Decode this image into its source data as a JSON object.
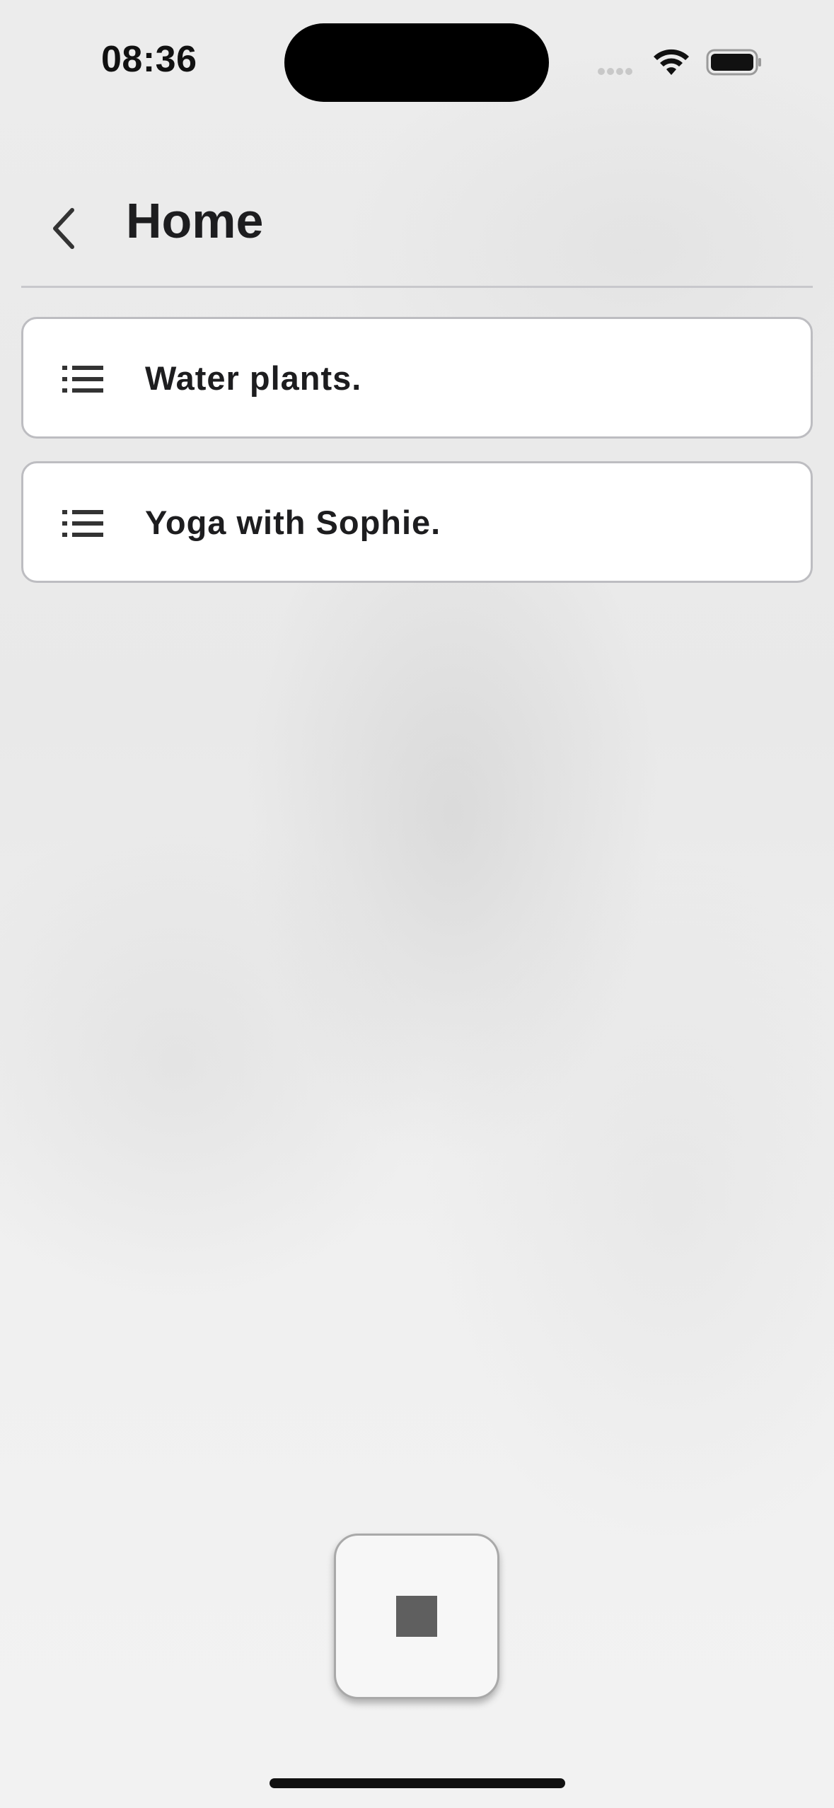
{
  "status_bar": {
    "time": "08:36"
  },
  "header": {
    "title": "Home",
    "back_icon": "chevron-left-icon"
  },
  "tasks": [
    {
      "label": "Water plants.",
      "icon": "list-icon"
    },
    {
      "label": "Yoga with Sophie.",
      "icon": "list-icon"
    }
  ],
  "controls": {
    "stop_icon": "stop-icon"
  },
  "colors": {
    "text": "#1d1d1f",
    "card_border": "#bdbdc1",
    "card_background": "#ffffff",
    "stop_fill": "#5f5f5f"
  }
}
